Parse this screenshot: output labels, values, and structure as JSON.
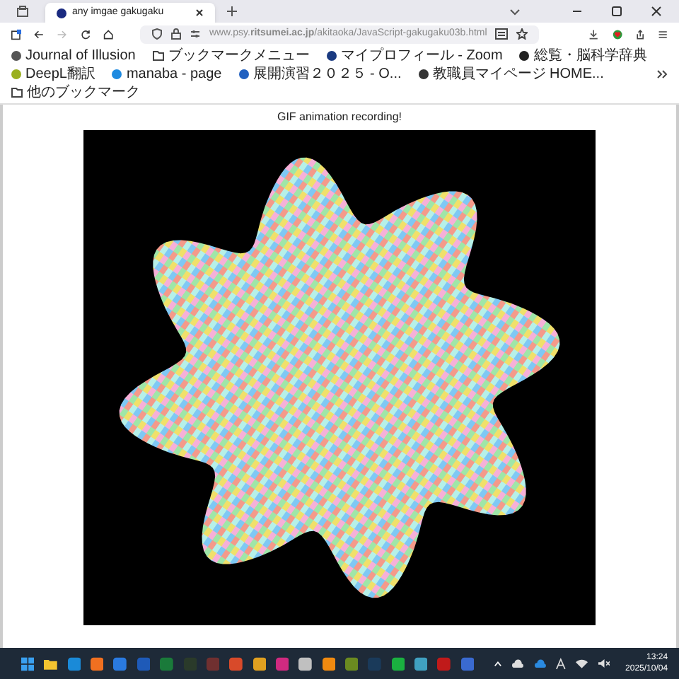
{
  "tabs": [
    {
      "title": "any imgae gakugaku",
      "selected": true
    }
  ],
  "address_bar": {
    "url": "www.psy.**ritsumei.ac.jp**/akitaoka/JavaScript-gakugaku03b.html"
  },
  "bookmarks": [
    {
      "label": "Journal of Illusion",
      "kind": "site"
    },
    {
      "label": "ブックマークメニュー",
      "kind": "folder"
    },
    {
      "label": "マイプロフィール - Zoom",
      "kind": "site"
    },
    {
      "label": "総覧・脳科学辞典",
      "kind": "site"
    },
    {
      "label": "DeepL翻訳",
      "kind": "site"
    },
    {
      "label": "manaba - page",
      "kind": "site"
    },
    {
      "label": "展開演習２０２５ - O...",
      "kind": "site"
    },
    {
      "label": "教職員マイページ HOME...",
      "kind": "site"
    }
  ],
  "other_bookmarks": "他のブックマーク",
  "page": {
    "heading": "GIF animation recording!"
  },
  "clock": {
    "time": "13:24",
    "date": "2025/10/04"
  }
}
